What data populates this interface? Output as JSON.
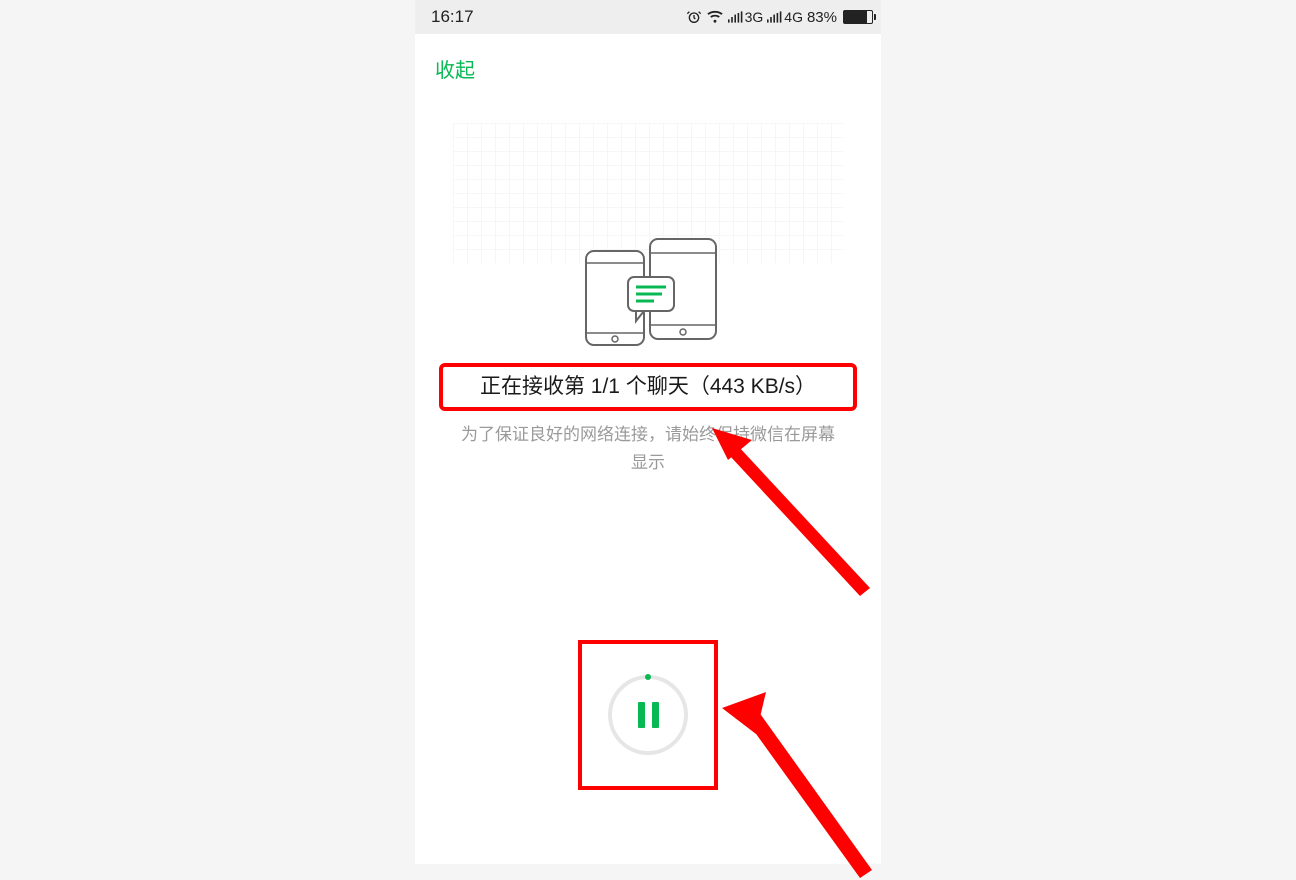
{
  "status_bar": {
    "time": "16:17",
    "network_3g": "3G",
    "network_4g": "4G",
    "battery_percent": "83%"
  },
  "header": {
    "collapse_label": "收起"
  },
  "main": {
    "progress_title": "正在接收第 1/1 个聊天（443 KB/s）",
    "hint": "为了保证良好的网络连接，请始终保持微信在屏幕显示"
  },
  "icons": {
    "alarm": "alarm-icon",
    "wifi": "wifi-icon",
    "signal": "signal-icon",
    "battery": "battery-icon",
    "pause": "pause-icon",
    "phones": "phone-transfer-icon"
  },
  "annotation": {
    "color": "#ff0000"
  }
}
